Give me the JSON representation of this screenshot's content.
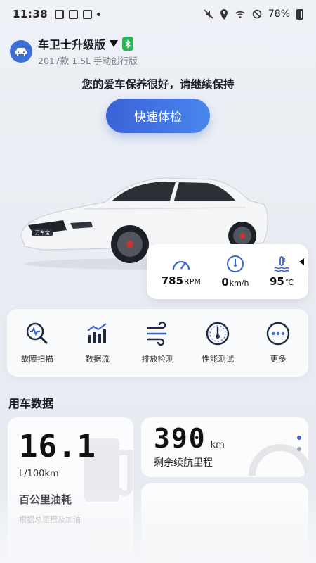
{
  "status_bar": {
    "time": "11:38",
    "battery": "78%"
  },
  "vehicle": {
    "name": "车卫士升级版",
    "model": "2017款 1.5L 手动创行版"
  },
  "health_message": "您的爱车保养很好，请继续保持",
  "quick_check_label": "快速体检",
  "car_image_badge": "万车宝",
  "gauges": [
    {
      "value": "785",
      "unit": "RPM",
      "icon": "tachometer-icon"
    },
    {
      "value": "0",
      "unit": "km/h",
      "icon": "speedometer-icon"
    },
    {
      "value": "95",
      "unit": "℃",
      "icon": "coolant-temperature-icon"
    }
  ],
  "tools": [
    {
      "label": "故障扫描",
      "icon": "fault-scan-icon"
    },
    {
      "label": "数据流",
      "icon": "data-stream-icon"
    },
    {
      "label": "排放检测",
      "icon": "emission-icon"
    },
    {
      "label": "性能测试",
      "icon": "performance-icon"
    },
    {
      "label": "更多",
      "icon": "more-icon"
    }
  ],
  "usage_section_title": "用车数据",
  "fuel_card": {
    "value": "16.1",
    "unit": "L/100km",
    "title": "百公里油耗",
    "note": "根据总里程及加油"
  },
  "range_card": {
    "value": "390",
    "unit": "km",
    "title": "剩余续航里程"
  },
  "colors": {
    "accent": "#3a62d8",
    "bluetooth": "#2fb35a"
  }
}
